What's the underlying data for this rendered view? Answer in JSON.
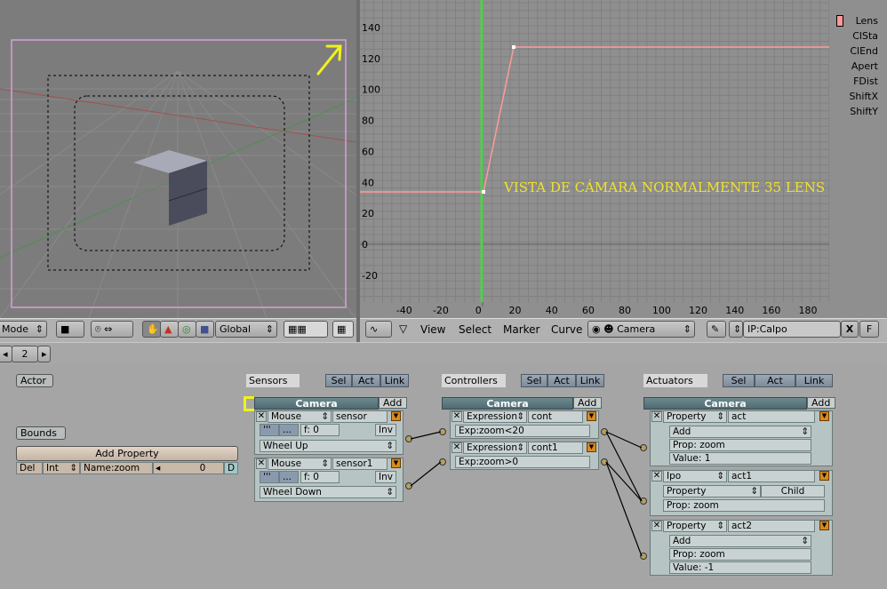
{
  "viewport3d": {
    "header": {
      "mode_label": "Mode",
      "orientation_label": "Global"
    }
  },
  "ipo": {
    "annotation": "VISTA DE CÁMARA NORMALMENTE 35 LENS",
    "y_ticks": [
      "140",
      "120",
      "100",
      "80",
      "60",
      "40",
      "20",
      "0",
      "-20"
    ],
    "x_ticks": [
      "-40",
      "-20",
      "0",
      "20",
      "40",
      "60",
      "80",
      "100",
      "120",
      "140",
      "160",
      "180"
    ],
    "channels": [
      "Lens",
      "ClSta",
      "ClEnd",
      "Apert",
      "FDist",
      "ShiftX",
      "ShiftY"
    ],
    "header": {
      "menu_view": "View",
      "menu_select": "Select",
      "menu_marker": "Marker",
      "menu_curve": "Curve",
      "object_select": "Camera",
      "ipo_name": "IP:Calpo",
      "x_button": "X",
      "f_button": "F"
    },
    "colors": {
      "curve": "#ff9a9a",
      "frame_line": "#4fd04f",
      "annotation": "#f0e030"
    }
  },
  "logic": {
    "frame_number": "2",
    "actor_button": "Actor",
    "bounds_button": "Bounds",
    "add_property_button": "Add Property",
    "property": {
      "del": "Del",
      "type": "Int",
      "name": "Name:zoom",
      "value": "0",
      "d": "D"
    },
    "sensors": {
      "title": "Sensors",
      "sel": "Sel",
      "act": "Act",
      "link": "Link",
      "object": "Camera",
      "add": "Add",
      "items": [
        {
          "type": "Mouse",
          "name": "sensor",
          "f": "f: 0",
          "inv": "Inv",
          "event": "Wheel Up"
        },
        {
          "type": "Mouse",
          "name": "sensor1",
          "f": "f: 0",
          "inv": "Inv",
          "event": "Wheel Down"
        }
      ]
    },
    "controllers": {
      "title": "Controllers",
      "sel": "Sel",
      "act": "Act",
      "link": "Link",
      "object": "Camera",
      "add": "Add",
      "items": [
        {
          "type": "Expression",
          "name": "cont",
          "expr": "Exp:zoom<20"
        },
        {
          "type": "Expression",
          "name": "cont1",
          "expr": "Exp:zoom>0"
        }
      ]
    },
    "actuators": {
      "title": "Actuators",
      "sel": "Sel",
      "act": "Act",
      "link": "Link",
      "object": "Camera",
      "add": "Add",
      "items": [
        {
          "type": "Property",
          "name": "act",
          "mode": "Add",
          "prop": "Prop: zoom",
          "value": "Value: 1"
        },
        {
          "type": "Ipo",
          "name": "act1",
          "mode": "Property",
          "child": "Child",
          "prop": "Prop: zoom"
        },
        {
          "type": "Property",
          "name": "act2",
          "mode": "Add",
          "prop": "Prop: zoom",
          "value": "Value: -1"
        }
      ]
    }
  }
}
